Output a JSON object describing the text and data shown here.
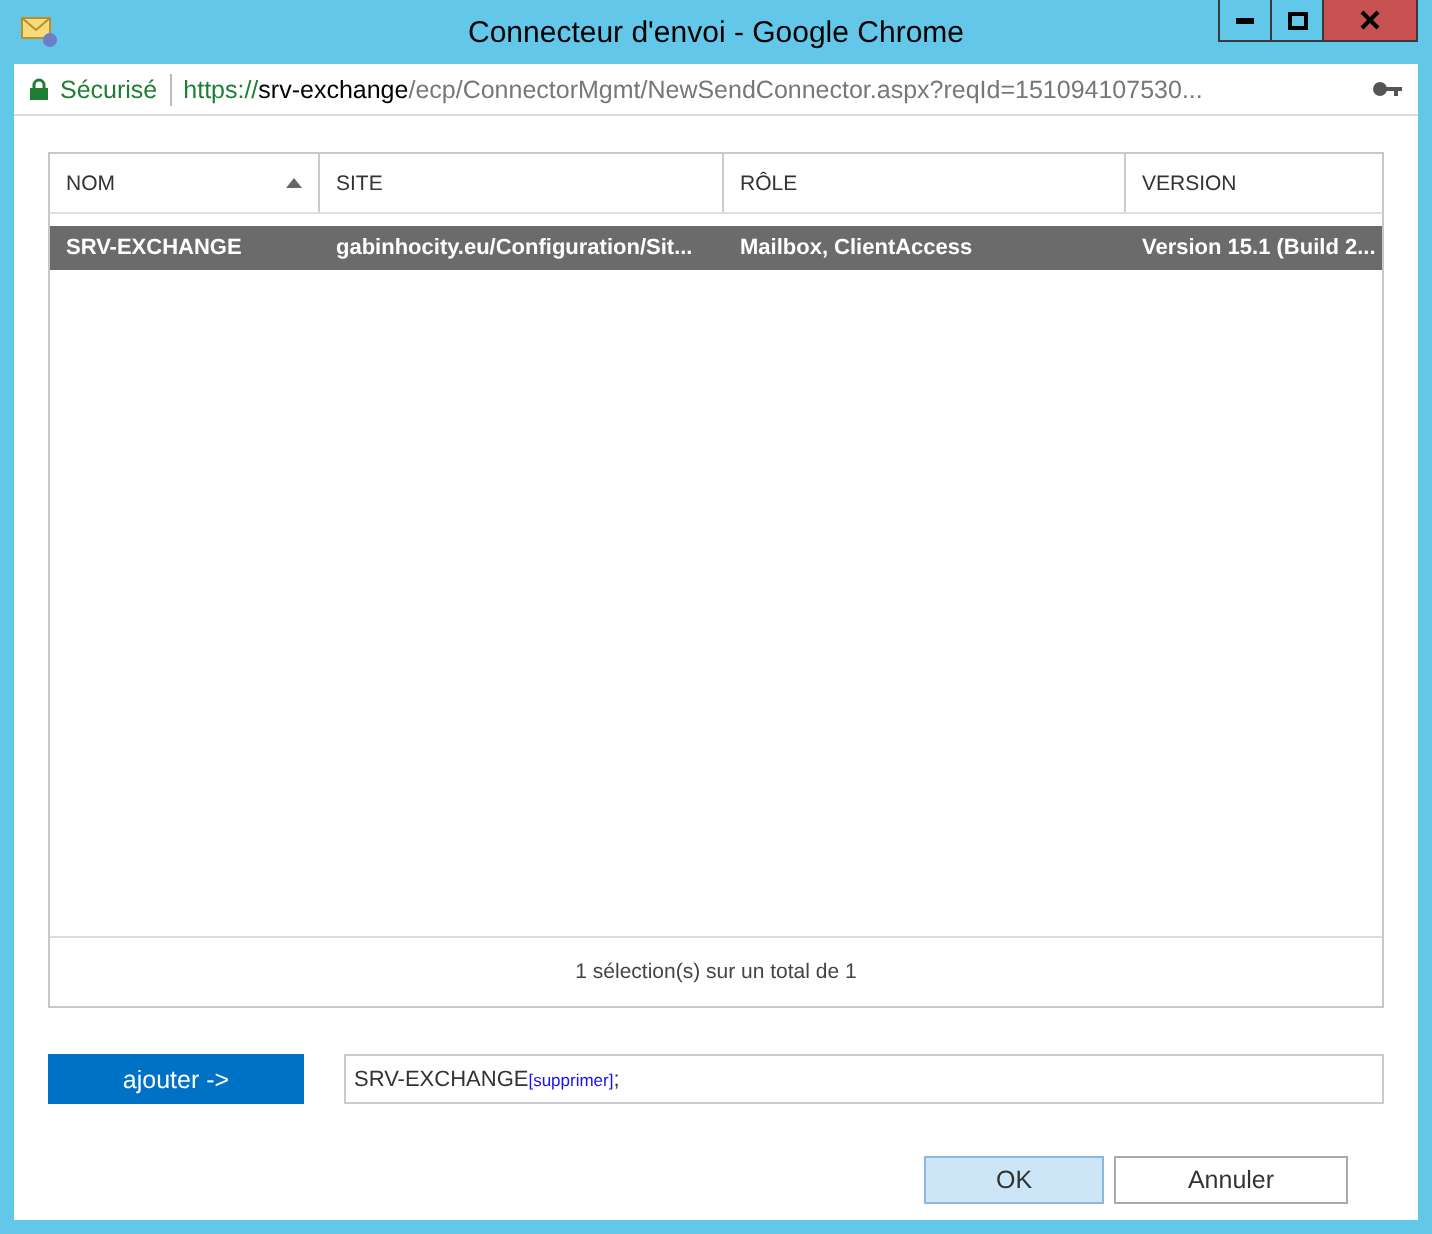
{
  "window": {
    "title": "Connecteur d'envoi - Google Chrome"
  },
  "address_bar": {
    "security": "Sécurisé",
    "url_scheme": "https://",
    "url_host": "srv-exchange",
    "url_rest": "/ecp/ConnectorMgmt/NewSendConnector.aspx?reqId=151094107530..."
  },
  "table": {
    "columns": [
      {
        "label": "NOM",
        "sorted": true
      },
      {
        "label": "SITE",
        "sorted": false
      },
      {
        "label": "RÔLE",
        "sorted": false
      },
      {
        "label": "VERSION",
        "sorted": false
      }
    ],
    "rows": [
      {
        "cells": [
          "SRV-EXCHANGE",
          "gabinhocity.eu/Configuration/Sit...",
          "Mailbox, ClientAccess",
          "Version 15.1 (Build 2..."
        ],
        "selected": true
      }
    ],
    "footer": "1 sélection(s) sur un total de 1"
  },
  "picker": {
    "add_button": "ajouter ->",
    "entries": [
      {
        "name": "SRV-EXCHANGE",
        "remove": "[supprimer]",
        "separator": ";"
      }
    ]
  },
  "buttons": [
    {
      "label": "OK",
      "default": true
    },
    {
      "label": "Annuler",
      "default": false
    }
  ]
}
